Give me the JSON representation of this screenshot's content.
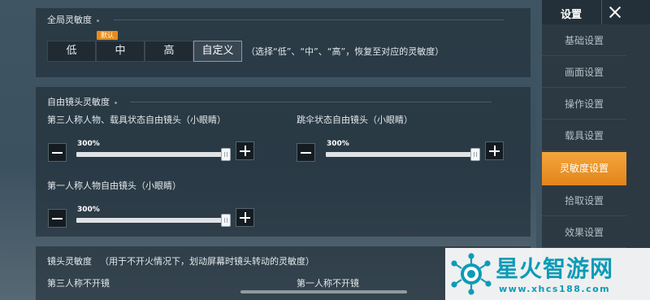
{
  "global_sensitivity": {
    "title": "全局灵敏度",
    "default_badge": "默认",
    "options": [
      "低",
      "中",
      "高",
      "自定义"
    ],
    "selected": "自定义",
    "hint": "（选择“低”、“中”、“高”，恢复至对应的灵敏度）"
  },
  "free_camera": {
    "title": "自由镜头灵敏度",
    "sliders": [
      {
        "label": "第三人称人物、载具状态自由镜头（小眼睛）",
        "value_text": "300%",
        "fraction": 1.0
      },
      {
        "label": "跳伞状态自由镜头（小眼睛）",
        "value_text": "300%",
        "fraction": 1.0
      },
      {
        "label": "第一人称人物自由镜头（小眼睛）",
        "value_text": "300%",
        "fraction": 1.0
      }
    ]
  },
  "camera_sensitivity": {
    "title": "镜头灵敏度",
    "note": "（用于不开火情况下，划动屏幕时镜头转动的灵敏度）",
    "third_person_label": "第三人称不开镜",
    "first_person_label": "第一人称不开镜"
  },
  "sidebar": {
    "title": "设置",
    "items": [
      "基础设置",
      "画面设置",
      "操作设置",
      "载具设置",
      "灵敏度设置",
      "拾取设置",
      "效果设置"
    ],
    "active": "灵敏度设置"
  },
  "watermark": {
    "brand": "星火智游网",
    "url": "www.xhcs188.com"
  },
  "colors": {
    "accent": "#e98b1a",
    "brand": "#0d9bb7"
  }
}
